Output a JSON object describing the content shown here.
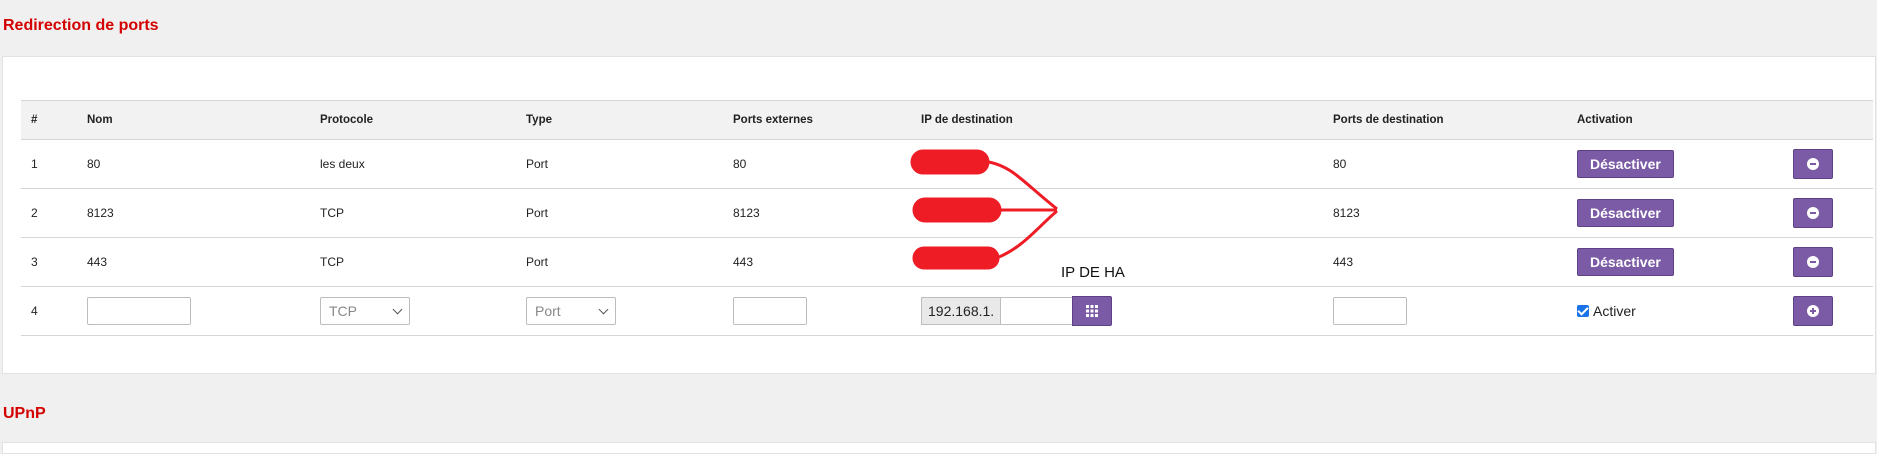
{
  "sections": {
    "port_forwarding_title": "Redirection de ports",
    "upnp_title": "UPnP"
  },
  "table": {
    "headers": [
      "#",
      "Nom",
      "Protocole",
      "Type",
      "Ports externes",
      "IP de destination",
      "Ports de destination",
      "Activation",
      ""
    ],
    "rows": [
      {
        "index": "1",
        "name": "80",
        "protocol": "les deux",
        "type": "Port",
        "ext_ports": "80",
        "dest_ip": "",
        "dest_ports": "80",
        "action_label": "Désactiver"
      },
      {
        "index": "2",
        "name": "8123",
        "protocol": "TCP",
        "type": "Port",
        "ext_ports": "8123",
        "dest_ip": "",
        "dest_ports": "8123",
        "action_label": "Désactiver"
      },
      {
        "index": "3",
        "name": "443",
        "protocol": "TCP",
        "type": "Port",
        "ext_ports": "443",
        "dest_ip": "",
        "dest_ports": "443",
        "action_label": "Désactiver"
      }
    ],
    "new_row": {
      "index": "4",
      "name_value": "",
      "protocol_value": "TCP",
      "type_value": "Port",
      "ext_ports_value": "",
      "ip_prefix": "192.168.1.",
      "ip_suffix_value": "",
      "dest_ports_value": "",
      "activate_label": "Activer",
      "activate_checked": true
    }
  },
  "annotation": {
    "text": "IP DE HA",
    "color": "#ee1c25"
  },
  "colors": {
    "accent": "#7b5aa6",
    "title": "#d40000"
  }
}
